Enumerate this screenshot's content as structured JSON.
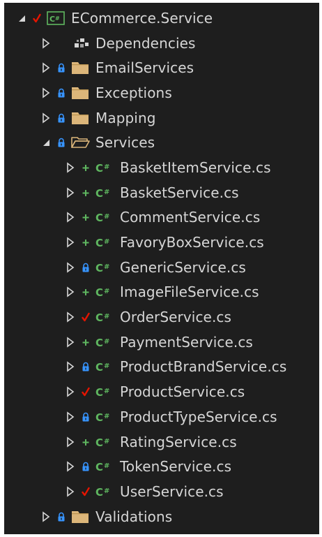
{
  "colors": {
    "background": "#1e1e1e",
    "text": "#d6d6d6",
    "folder": "#dcb67a",
    "csharp": "#5fb760",
    "lock": "#3794ff",
    "check": "#e51400",
    "plus": "#5fb760"
  },
  "tree": {
    "project": {
      "label": "ECommerce.Service",
      "status_icon": "red-check-icon",
      "icon": "csharp-project-icon",
      "expanded": true
    },
    "dependencies": {
      "label": "Dependencies",
      "icon": "dependencies-icon"
    },
    "folders": [
      {
        "label": "EmailServices",
        "status_icon": "lock-icon",
        "expanded": false
      },
      {
        "label": "Exceptions",
        "status_icon": "lock-icon",
        "expanded": false
      },
      {
        "label": "Mapping",
        "status_icon": "lock-icon",
        "expanded": false
      },
      {
        "label": "Services",
        "status_icon": "lock-icon",
        "expanded": true
      }
    ],
    "files": [
      {
        "label": "BasketItemService.cs",
        "status_icon": "plus-icon"
      },
      {
        "label": "BasketService.cs",
        "status_icon": "plus-icon"
      },
      {
        "label": "CommentService.cs",
        "status_icon": "plus-icon"
      },
      {
        "label": "FavoryBoxService.cs",
        "status_icon": "plus-icon"
      },
      {
        "label": "GenericService.cs",
        "status_icon": "lock-icon"
      },
      {
        "label": "ImageFileService.cs",
        "status_icon": "plus-icon"
      },
      {
        "label": "OrderService.cs",
        "status_icon": "red-check-icon"
      },
      {
        "label": "PaymentService.cs",
        "status_icon": "plus-icon"
      },
      {
        "label": "ProductBrandService.cs",
        "status_icon": "lock-icon"
      },
      {
        "label": "ProductService.cs",
        "status_icon": "red-check-icon"
      },
      {
        "label": "ProductTypeService.cs",
        "status_icon": "lock-icon"
      },
      {
        "label": "RatingService.cs",
        "status_icon": "plus-icon"
      },
      {
        "label": "TokenService.cs",
        "status_icon": "lock-icon"
      },
      {
        "label": "UserService.cs",
        "status_icon": "red-check-icon"
      }
    ],
    "last_folder": {
      "label": "Validations",
      "status_icon": "lock-icon",
      "expanded": false
    }
  }
}
